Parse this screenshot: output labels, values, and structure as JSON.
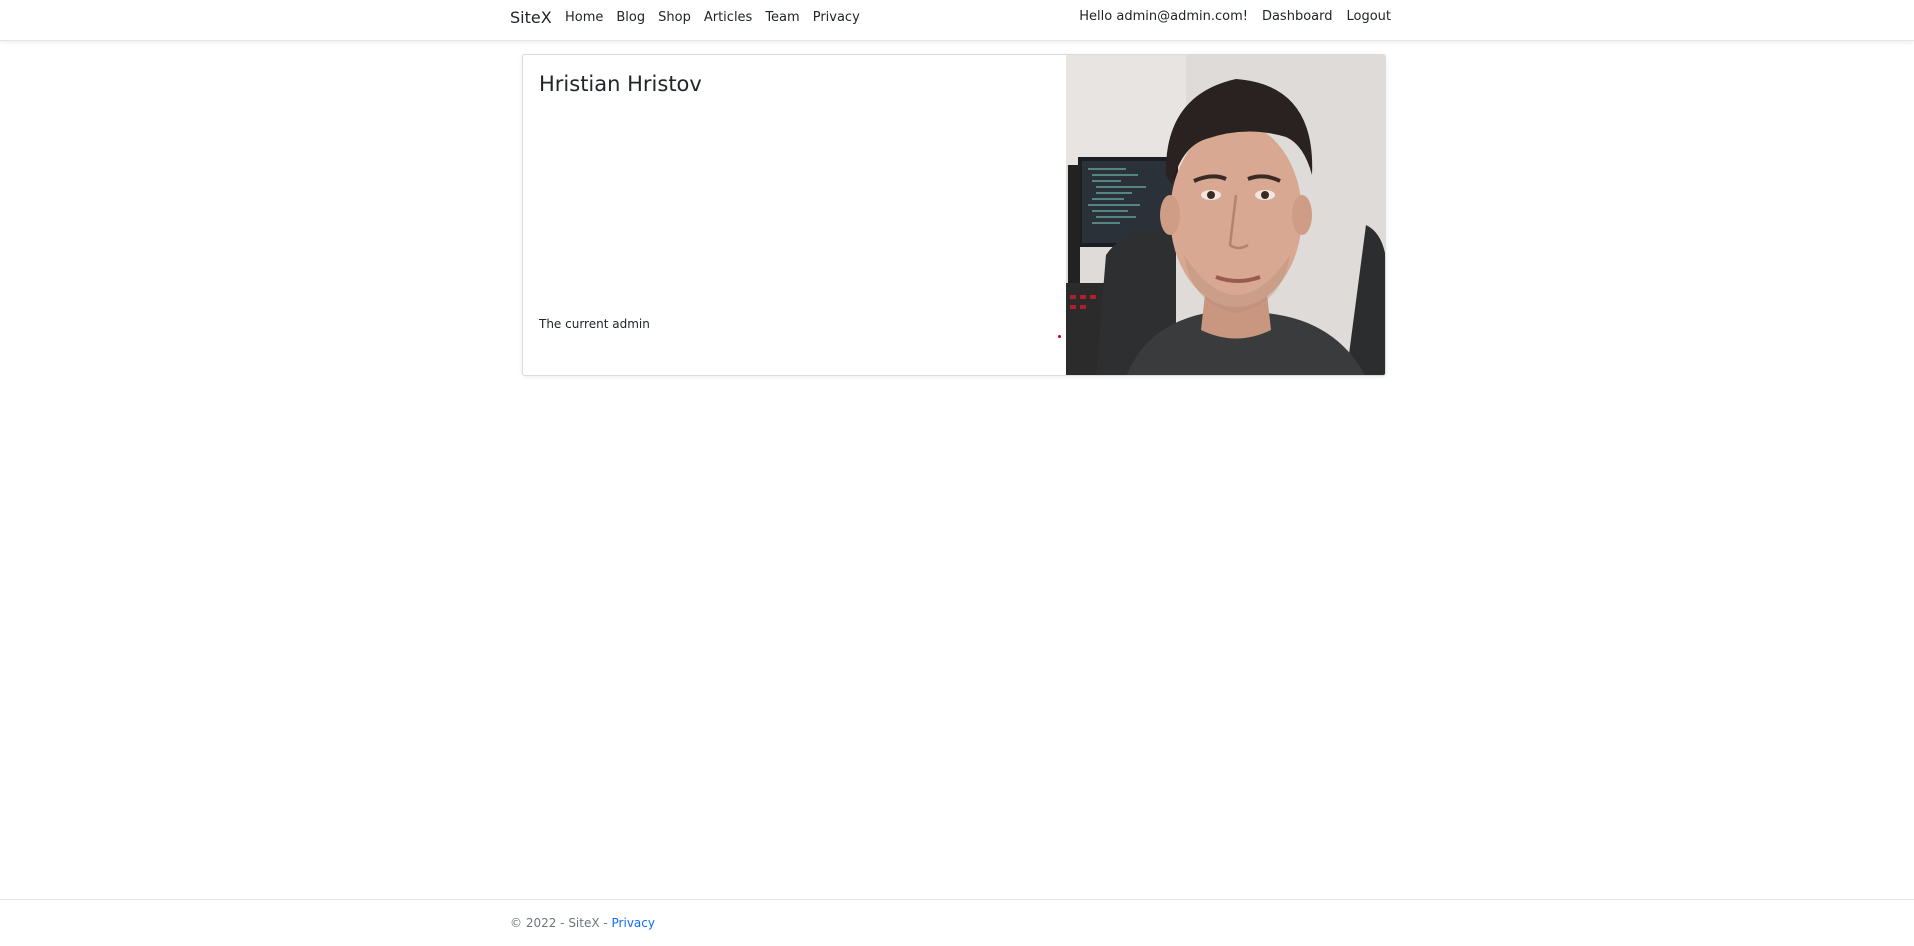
{
  "nav": {
    "brand": "SiteX",
    "links": [
      "Home",
      "Blog",
      "Shop",
      "Articles",
      "Team",
      "Privacy"
    ],
    "greeting": "Hello admin@admin.com!",
    "dashboard": "Dashboard",
    "logout": "Logout"
  },
  "card": {
    "name": "Hristian Hristov",
    "description": "The current admin"
  },
  "footer": {
    "copyright": "© 2022 - SiteX - ",
    "privacy": "Privacy"
  },
  "colors": {
    "link": "#0d6efd",
    "muted": "#6c757d",
    "dot": "#c0001a"
  }
}
